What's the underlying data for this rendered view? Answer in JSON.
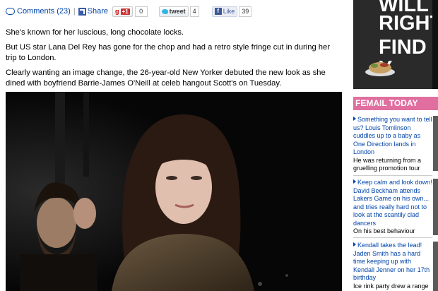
{
  "share_bar": {
    "comments_label": "Comments",
    "comments_count": "(23)",
    "share_label": "Share",
    "gplus_label": "g",
    "gplus_plus1": "+1",
    "gplus_count": "0",
    "tweet_label": "tweet",
    "tweet_count": "4",
    "like_label": "Like",
    "like_count": "39"
  },
  "article": {
    "paragraphs": [
      "She's known for her luscious, long chocolate locks.",
      "But US star Lana Del Rey has gone for the chop and had a retro style fringe cut in during her trip to London.",
      "Clearly wanting an image change, the 26-year-old New Yorker debuted the new look as she dined with boyfriend Barrie-James O'Neill at celeb hangout Scott's on Tuesday."
    ]
  },
  "ad": {
    "lines": [
      "WILL",
      "RIGHT",
      "FIND Y"
    ]
  },
  "femail": {
    "header": "FEMAIL TODAY",
    "items": [
      {
        "headline": "Something you want to tell us? Louis Tomlinson cuddles up to a baby as One Direction lands in London",
        "teaser": "He was returning from a gruelling promotion tour"
      },
      {
        "headline": "Keep calm and look down! David Beckham attends Lakers Game on his own... and tries really hard not to look at the scantily clad dancers",
        "teaser": "On his best behaviour"
      },
      {
        "headline": "Kendall takes the lead! Jaden Smith has a hard time keeping up with Kendall Jenner on her 17th birthday",
        "teaser": "Ice rink party drew a range of celebs"
      }
    ]
  },
  "colors": {
    "link": "#0044aa",
    "femail_pink": "#e06fa0",
    "photo_bg": "#080808"
  }
}
